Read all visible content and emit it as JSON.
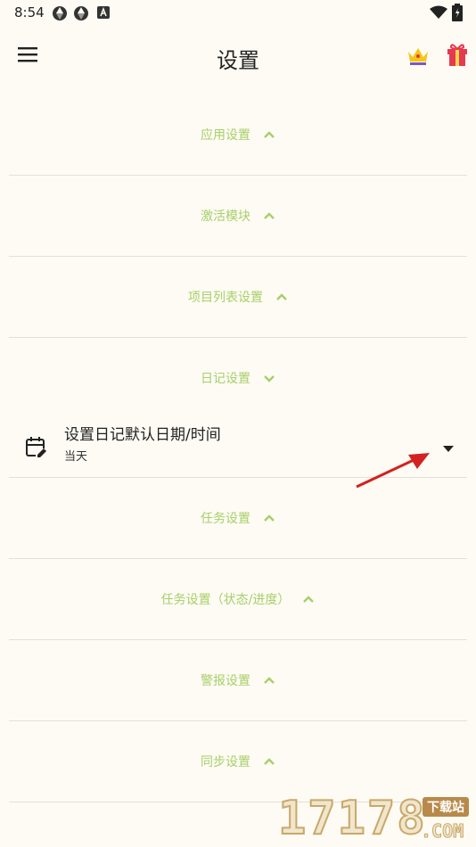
{
  "status_bar": {
    "time": "8:54",
    "icons": [
      "aperture-icon",
      "aperture-icon",
      "a-square-icon",
      "wifi-icon",
      "battery-icon"
    ]
  },
  "app_bar": {
    "title": "设置",
    "icons": [
      "menu-icon",
      "crown-icon",
      "gift-icon"
    ]
  },
  "colors": {
    "background": "#FDFBF3",
    "section_header": "#A8CF6A",
    "divider": "#E3E0D8",
    "arrow": "#D22222"
  },
  "sections": [
    {
      "label": "应用设置",
      "expanded": false
    },
    {
      "label": "激活模块",
      "expanded": false
    },
    {
      "label": "项目列表设置",
      "expanded": false
    },
    {
      "label": "日记设置",
      "expanded": true,
      "item": {
        "label": "设置日记默认日期/时间",
        "value": "当天",
        "icon": "calendar-edit-icon"
      }
    },
    {
      "label": "任务设置",
      "expanded": false
    },
    {
      "label": "任务设置（状态/进度）",
      "expanded": false
    },
    {
      "label": "警报设置",
      "expanded": false
    },
    {
      "label": "同步设置",
      "expanded": false
    }
  ],
  "watermark": {
    "number": "17178",
    "badge": "下载站",
    "domain": ".COM"
  }
}
